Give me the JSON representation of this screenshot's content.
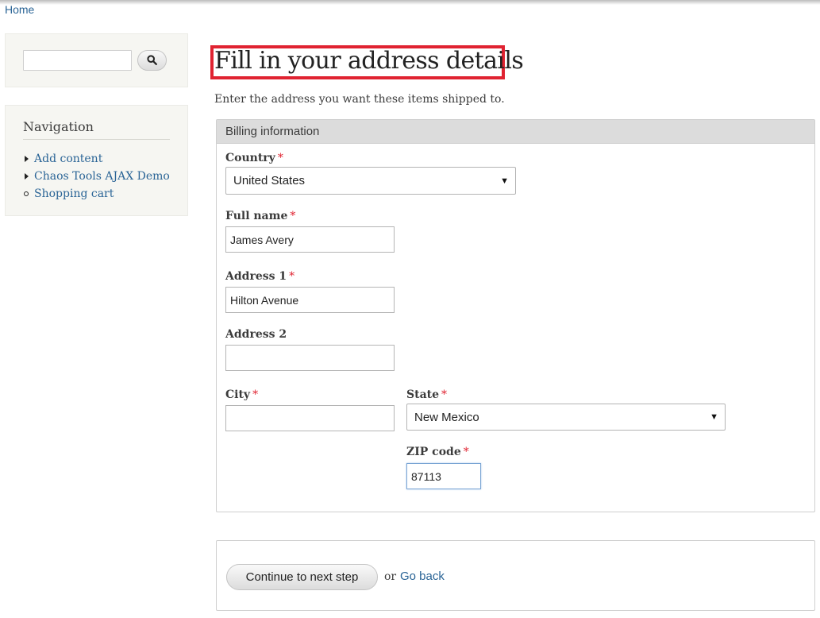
{
  "breadcrumb": {
    "home": "Home"
  },
  "search": {
    "placeholder": "",
    "button_icon": "search-icon"
  },
  "navigation": {
    "title": "Navigation",
    "items": [
      {
        "label": "Add content",
        "bullet": "collapsed-triangle"
      },
      {
        "label": "Chaos Tools AJAX Demo",
        "bullet": "collapsed-triangle"
      },
      {
        "label": "Shopping cart",
        "bullet": "circle"
      }
    ]
  },
  "page": {
    "title": "Fill in your address details",
    "description": "Enter the address you want these items shipped to."
  },
  "billing": {
    "legend": "Billing information",
    "required_marker": "*",
    "country": {
      "label": "Country",
      "value": "United States"
    },
    "full_name": {
      "label": "Full name",
      "value": "James Avery"
    },
    "address1": {
      "label": "Address 1",
      "value": "Hilton Avenue"
    },
    "address2": {
      "label": "Address 2",
      "value": ""
    },
    "city": {
      "label": "City",
      "value": ""
    },
    "state": {
      "label": "State",
      "value": "New Mexico"
    },
    "zip": {
      "label": "ZIP code",
      "value": "87113"
    }
  },
  "actions": {
    "continue_label": "Continue to next step",
    "or_text": "or",
    "go_back_label": "Go back"
  },
  "colors": {
    "link": "#2a6496",
    "required": "#e02331",
    "title_highlight": "#e02331",
    "sidebar_bg": "#f6f6f2",
    "legend_bg": "#dcdcdc"
  }
}
